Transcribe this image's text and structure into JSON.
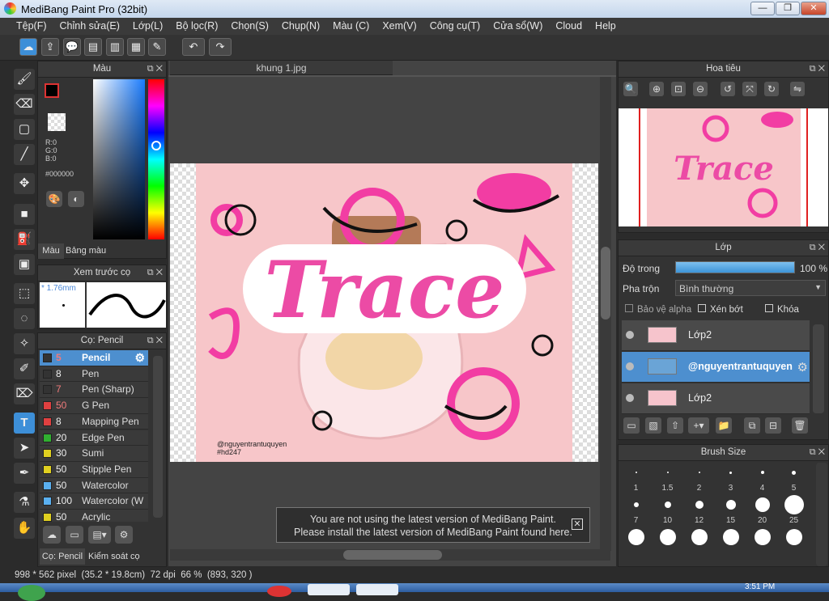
{
  "window": {
    "title": "MediBang Paint Pro (32bit)"
  },
  "menu": [
    "Tệp(F)",
    "Chỉnh sửa(E)",
    "Lớp(L)",
    "Bộ lọc(R)",
    "Chọn(S)",
    "Chụp(N)",
    "Màu (C)",
    "Xem(V)",
    "Công cụ(T)",
    "Cửa sổ(W)",
    "Cloud",
    "Help"
  ],
  "color_panel": {
    "title": "Màu",
    "rgb": [
      "R:0",
      "G:0",
      "B:0"
    ],
    "hex": "#000000",
    "tabs": [
      "Màu",
      "Bảng màu"
    ],
    "fg": "#000000",
    "bg": "#ffffff"
  },
  "preview_panel": {
    "title": "Xem trước cọ",
    "size": "1.76mm"
  },
  "brush_panel": {
    "title": "Cọ: Pencil",
    "items": [
      {
        "size": "5",
        "name": "Pencil",
        "color": "#333333",
        "selected": true
      },
      {
        "size": "8",
        "name": "Pen",
        "color": "#333333"
      },
      {
        "size": "7",
        "name": "Pen (Sharp)",
        "color": "#333333"
      },
      {
        "size": "50",
        "name": "G Pen",
        "color": "#e04040"
      },
      {
        "size": "8",
        "name": "Mapping Pen",
        "color": "#e04040"
      },
      {
        "size": "20",
        "name": "Edge Pen",
        "color": "#30b030"
      },
      {
        "size": "30",
        "name": "Sumi",
        "color": "#e0d020"
      },
      {
        "size": "50",
        "name": "Stipple Pen",
        "color": "#e0d020"
      },
      {
        "size": "50",
        "name": "Watercolor",
        "color": "#5ab0f0"
      },
      {
        "size": "100",
        "name": "Watercolor (W",
        "color": "#5ab0f0"
      },
      {
        "size": "50",
        "name": "Acrylic",
        "color": "#e0d020"
      }
    ],
    "tabs": [
      "Cọ: Pencil",
      "Kiểm soát cọ"
    ]
  },
  "document": {
    "tab": "khung 1.jpg",
    "artwork_title": "Trace",
    "watermark_name": "@nguyentrantuquyen",
    "watermark_tag": "#hd247"
  },
  "notification": {
    "line1": "You are not using the latest version of MediBang Paint.",
    "line2": "Please install the latest version of MediBang Paint found here."
  },
  "navigator": {
    "title": "Hoa tiêu"
  },
  "layers_panel": {
    "title": "Lớp",
    "opacity_label": "Độ trong",
    "opacity_value": "100 %",
    "opacity_fraction": 1.0,
    "blend_label": "Pha trộn",
    "blend_value": "Bình thường",
    "options": [
      "Bảo vệ alpha",
      "Xén bớt",
      "Khóa"
    ],
    "layers": [
      {
        "name": "Lớp2"
      },
      {
        "name": "@nguyentrantuquyen",
        "selected": true
      },
      {
        "name": "Lớp2"
      }
    ]
  },
  "brush_size_panel": {
    "title": "Brush Size",
    "sizes": [
      "1",
      "1.5",
      "2",
      "3",
      "4",
      "5",
      "7",
      "10",
      "12",
      "15",
      "20",
      "25",
      "",
      "",
      "",
      "",
      "",
      ""
    ]
  },
  "status": {
    "dims": "998 * 562 pixel",
    "cm": "(35.2 * 19.8cm)",
    "dpi": "72 dpi",
    "zoom": "66 %",
    "coords": "(893, 320 )"
  },
  "taskbar": {
    "time": "3:51 PM"
  }
}
